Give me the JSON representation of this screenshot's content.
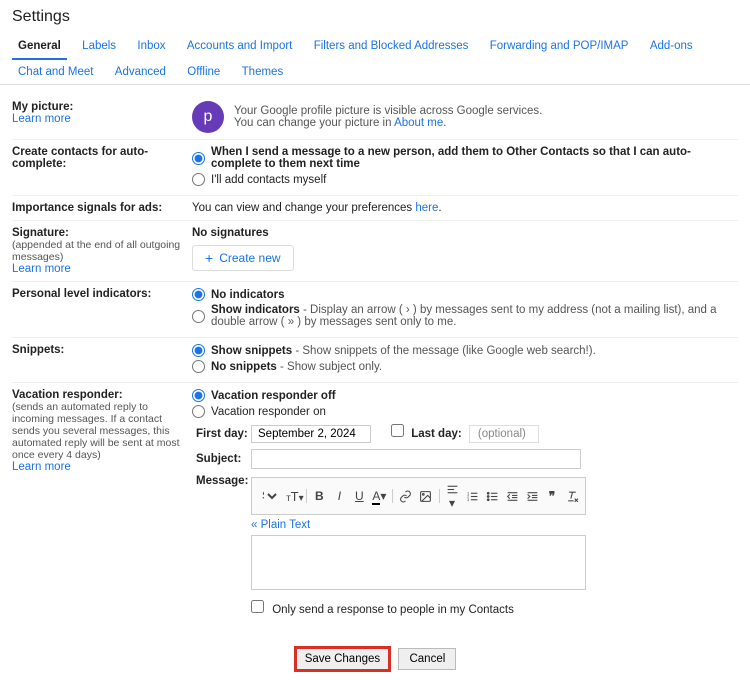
{
  "header": {
    "title": "Settings"
  },
  "tabs": [
    "General",
    "Labels",
    "Inbox",
    "Accounts and Import",
    "Filters and Blocked Addresses",
    "Forwarding and POP/IMAP",
    "Add-ons",
    "Chat and Meet",
    "Advanced",
    "Offline",
    "Themes"
  ],
  "picture": {
    "label": "My picture:",
    "learn": "Learn more",
    "avatar": "p",
    "line1a": "Your Google profile picture is visible across Google services.",
    "line2a": "You can change your picture in ",
    "about": "About me",
    "dot": "."
  },
  "contacts": {
    "label": "Create contacts for auto-complete:",
    "opt1": "When I send a message to a new person, add them to Other Contacts so that I can auto-complete to them next time",
    "opt2": "I'll add contacts myself"
  },
  "ads": {
    "label": "Importance signals for ads:",
    "text": "You can view and change your preferences ",
    "here": "here",
    "dot": "."
  },
  "signature": {
    "label": "Signature:",
    "sub": "(appended at the end of all outgoing messages)",
    "learn": "Learn more",
    "none": "No signatures",
    "create": "Create new"
  },
  "indicators": {
    "label": "Personal level indicators:",
    "opt1": "No indicators",
    "opt2b": "Show indicators",
    "opt2t": " - Display an arrow ( › ) by messages sent to my address (not a mailing list), and a double arrow ( » ) by messages sent only to me."
  },
  "snippets": {
    "label": "Snippets:",
    "opt1b": "Show snippets",
    "opt1t": " - Show snippets of the message (like Google web search!).",
    "opt2b": "No snippets",
    "opt2t": " - Show subject only."
  },
  "vacation": {
    "label": "Vacation responder:",
    "sub": "(sends an automated reply to incoming messages. If a contact sends you several messages, this automated reply will be sent at most once every 4 days)",
    "learn": "Learn more",
    "off": "Vacation responder off",
    "on": "Vacation responder on",
    "firstday": "First day:",
    "firstday_val": "September 2, 2024",
    "lastday": "Last day:",
    "optional": "(optional)",
    "subject": "Subject:",
    "message": "Message:",
    "font": "Sans Serif",
    "plaintext": "« Plain Text",
    "onlycontacts": "Only send a response to people in my Contacts"
  },
  "footer": {
    "save": "Save Changes",
    "cancel": "Cancel"
  }
}
